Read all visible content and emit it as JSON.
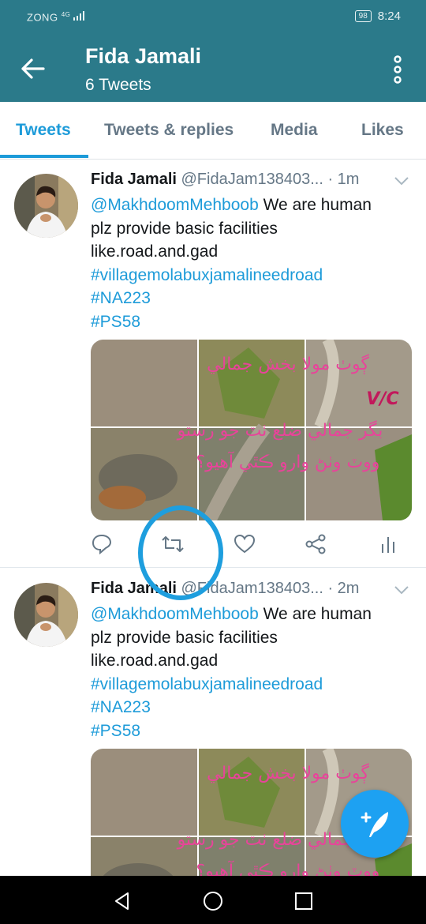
{
  "status_bar": {
    "carrier": "ZONG",
    "network": "4G",
    "battery": "98",
    "time": "8:24"
  },
  "header": {
    "title": "Fida Jamali",
    "subtitle": "6 Tweets",
    "back_icon": "arrow-left-icon",
    "menu_icon": "more-vertical-icon"
  },
  "tabs": [
    {
      "label": "Tweets",
      "active": true
    },
    {
      "label": "Tweets & replies",
      "active": false
    },
    {
      "label": "Media",
      "active": false
    },
    {
      "label": "Likes",
      "active": false
    }
  ],
  "tweets": [
    {
      "name": "Fida Jamali",
      "handle": "@FidaJam138403...",
      "time": "· 1m",
      "mention": "@MakhdoomMehboob",
      "text_line1": " We are human",
      "text_line2": "plz provide basic facilities",
      "text_line3": "like.road.and.gad",
      "hashtags": [
        "#villagemolabuxjamalineedroad",
        "#NA223",
        "#PS58"
      ],
      "image_overlay": [
        "ڳوٺ مولا بخش جمالي",
        "V/C",
        "بگر جمالي ضلع ٺٽ جو رستو",
        "ووٽ وٺڻ وارو ڪٿي آهيو؟"
      ]
    },
    {
      "name": "Fida Jamali",
      "handle": "@FidaJam138403...",
      "time": "· 2m",
      "mention": "@MakhdoomMehboob",
      "text_line1": " We are human",
      "text_line2": "plz provide basic facilities",
      "text_line3": "like.road.and.gad",
      "hashtags": [
        "#villagemolabuxjamalineedroad",
        "#NA223",
        "#PS58"
      ],
      "image_overlay": [
        "ڳوٺ مولا بخش جمالي",
        "بگر جمالي ضلع ٺٽ جو رستو",
        "ووٽ وٺڻ وارو ڪٿي آهيو؟"
      ]
    }
  ],
  "action_icons": [
    "reply-icon",
    "retweet-icon",
    "like-icon",
    "share-icon",
    "analytics-icon"
  ],
  "colors": {
    "appbar": "#2b7a8a",
    "accent": "#1d9bd9",
    "annotation": "#1e9ede",
    "overlay_text": "#e8449a"
  },
  "fab_icon": "compose-tweet-icon",
  "nav_icons": [
    "back-triangle-icon",
    "home-circle-icon",
    "recents-square-icon"
  ]
}
